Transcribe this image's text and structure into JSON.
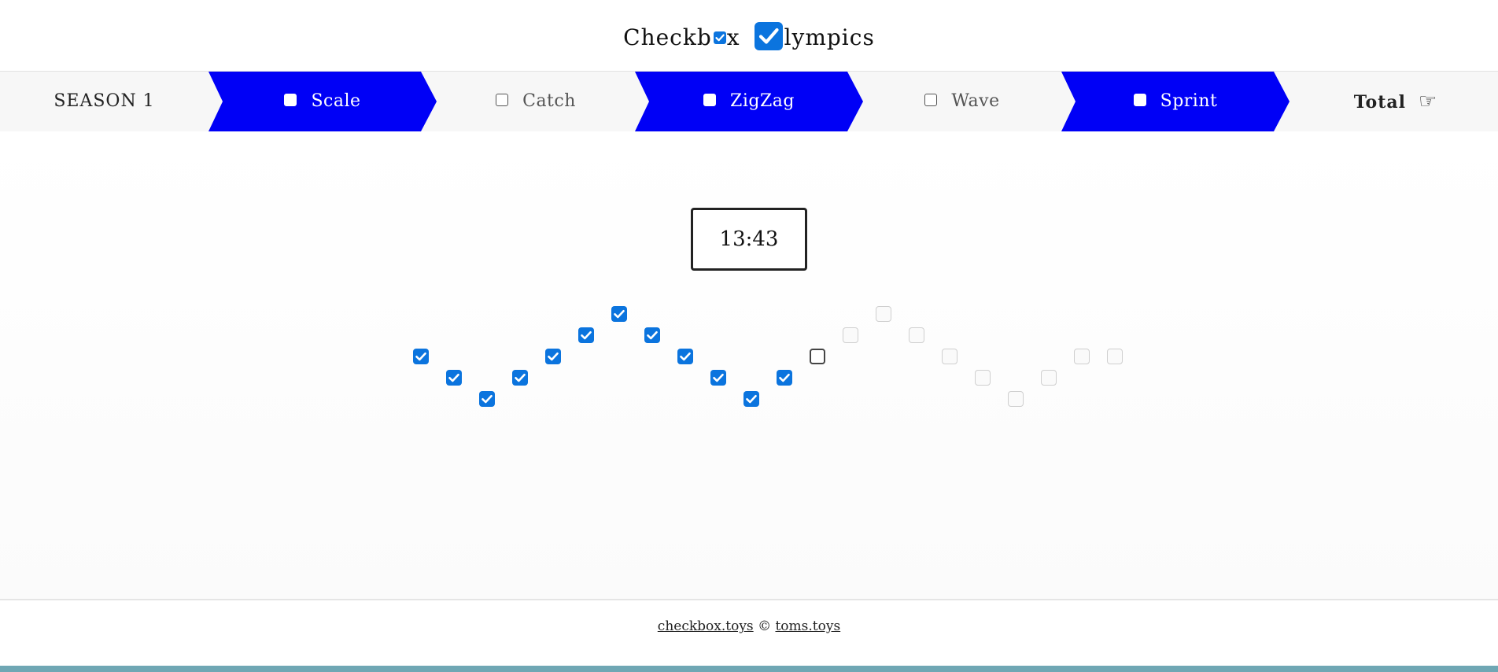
{
  "title": {
    "part1": "Checkb",
    "part2": "x",
    "part3": "lympics"
  },
  "nav": {
    "season_label": "SEASON 1",
    "events": [
      {
        "label": "Scale",
        "state": "active"
      },
      {
        "label": "Catch",
        "state": "inactive"
      },
      {
        "label": "ZigZag",
        "state": "active"
      },
      {
        "label": "Wave",
        "state": "inactive"
      },
      {
        "label": "Sprint",
        "state": "active"
      }
    ],
    "total_label": "Total",
    "total_icon": "☞"
  },
  "game": {
    "timer": "13:43",
    "checkboxes": [
      {
        "state": "checked"
      },
      {
        "state": "checked"
      },
      {
        "state": "checked"
      },
      {
        "state": "checked"
      },
      {
        "state": "checked"
      },
      {
        "state": "checked"
      },
      {
        "state": "checked"
      },
      {
        "state": "checked"
      },
      {
        "state": "checked"
      },
      {
        "state": "checked"
      },
      {
        "state": "checked"
      },
      {
        "state": "checked"
      },
      {
        "state": "active"
      },
      {
        "state": "dim"
      },
      {
        "state": "dim"
      },
      {
        "state": "dim"
      },
      {
        "state": "dim"
      },
      {
        "state": "dim"
      },
      {
        "state": "dim"
      },
      {
        "state": "dim"
      },
      {
        "state": "dim"
      },
      {
        "state": "dim"
      }
    ]
  },
  "footer": {
    "link1": "checkbox.toys",
    "separator": "©",
    "link2": "toms.toys"
  },
  "colors": {
    "accent_blue": "#0000f6",
    "checkbox_blue": "#0b74de",
    "bottom_bar": "#6fa7b4"
  }
}
